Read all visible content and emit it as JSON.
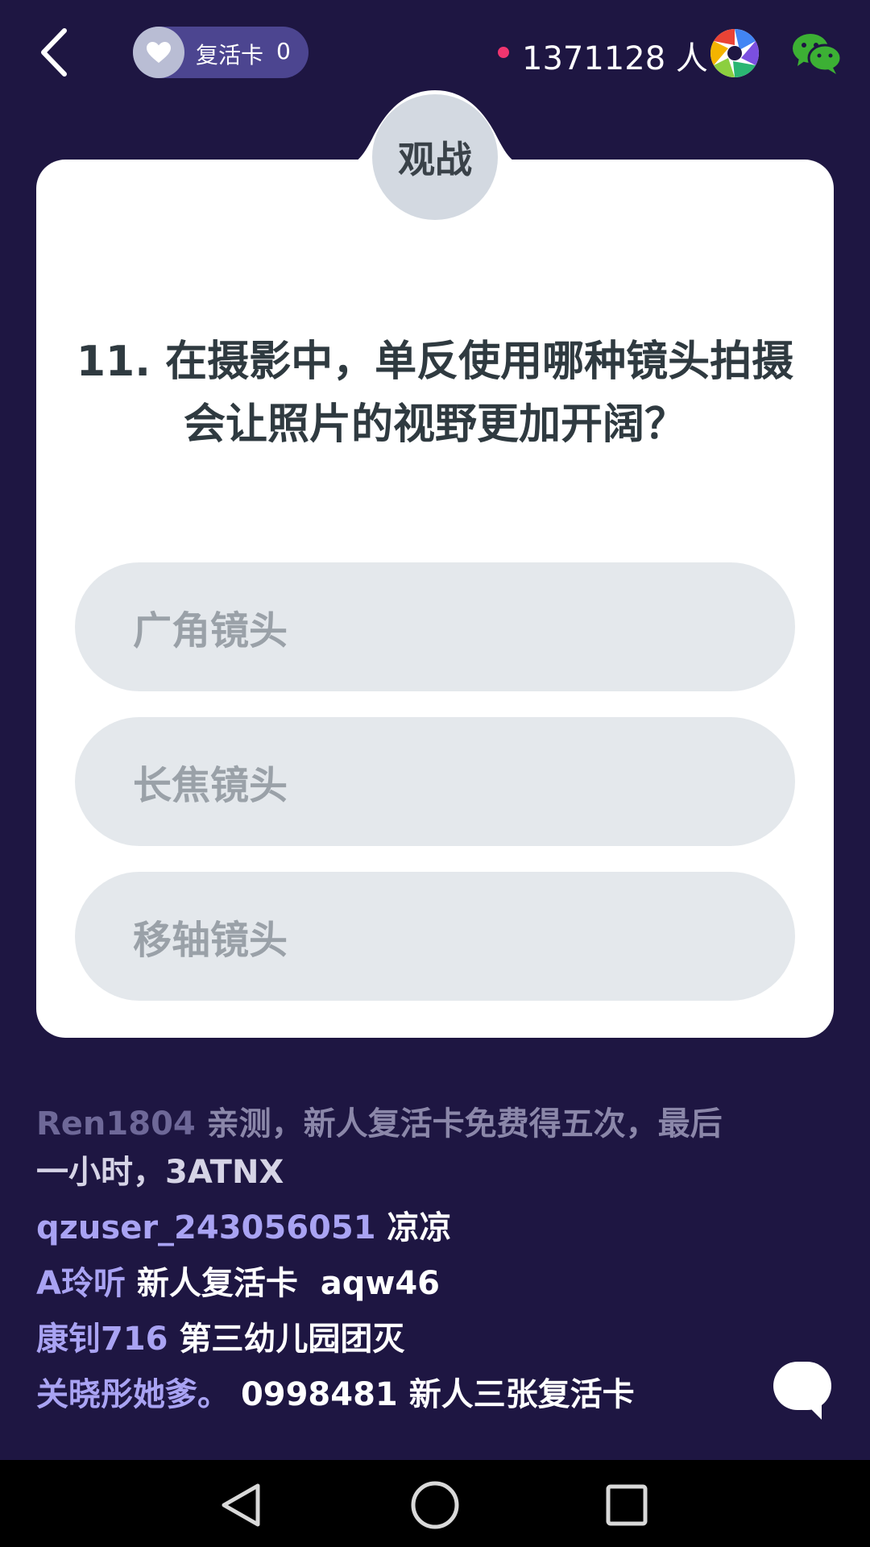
{
  "header": {
    "back_icon": "chevron-left-icon",
    "revive_card": {
      "icon": "heart-icon",
      "label": "复活卡",
      "count": "0"
    },
    "live_indicator_color": "#f0356f",
    "viewer_count": "1371128 人",
    "share_icons": [
      "aperture-share-icon",
      "wechat-icon"
    ]
  },
  "card": {
    "badge": "观战",
    "question": "11. 在摄影中，单反使用哪种镜头拍摄会让照片的视野更加开阔？",
    "options": [
      "广角镜头",
      "长焦镜头",
      "移轴镜头"
    ]
  },
  "chat": {
    "messages": [
      {
        "user": "Ren1804",
        "text": "亲测，新人复活卡免费得五次，最后",
        "text2": "一小时，3ATNX"
      },
      {
        "user": "qzuser_243056051",
        "text": "凉凉"
      },
      {
        "user": "A玲听",
        "text": "新人复活卡  aqw46"
      },
      {
        "user": "康钊716",
        "text": "第三幼儿园团灭"
      },
      {
        "user": "关晓彤她爹。",
        "text": "0998481 新人三张复活卡"
      }
    ],
    "chat_button_icon": "speech-bubble-icon"
  },
  "navbar": {
    "icons": [
      "nav-back-icon",
      "nav-home-icon",
      "nav-recents-icon"
    ]
  },
  "colors": {
    "background": "#1e1642",
    "card": "#ffffff",
    "option_bg": "#e4e8ec",
    "username": "#a9a3f3"
  }
}
